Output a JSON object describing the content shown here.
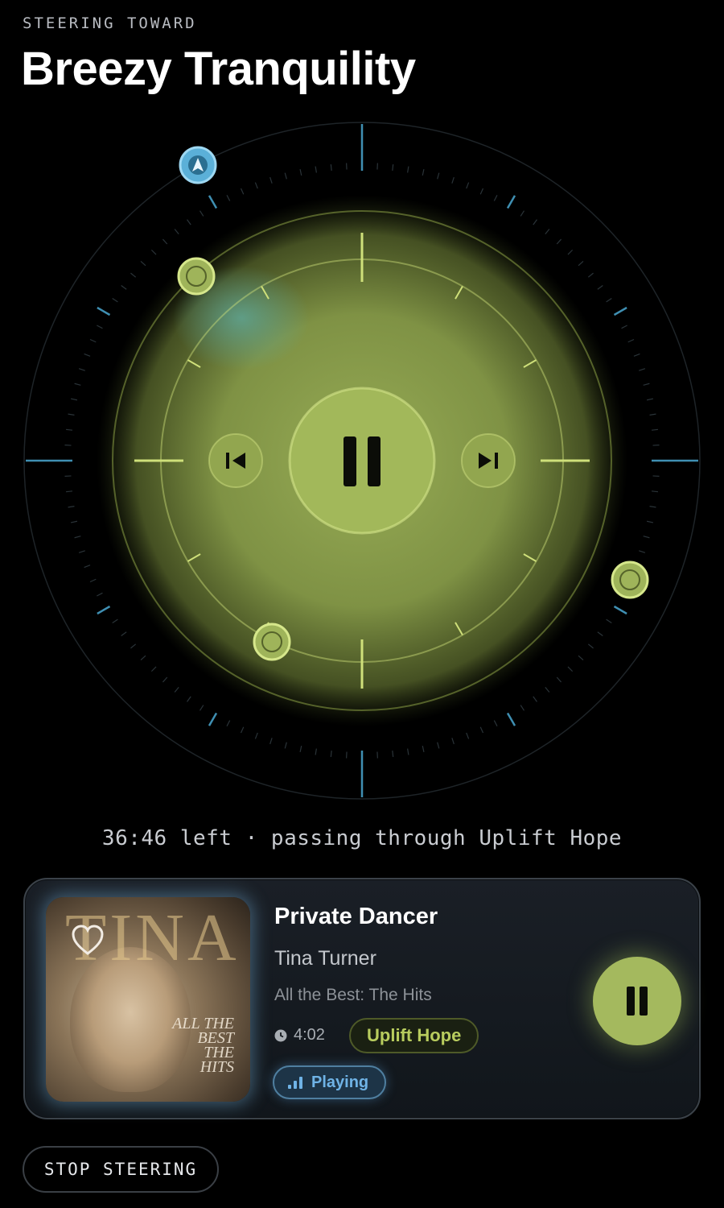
{
  "header": {
    "eyebrow": "STEERING TOWARD",
    "title": "Breezy Tranquility"
  },
  "status": {
    "text": "36:46 left · passing through Uplift Hope"
  },
  "now_playing": {
    "title": "Private Dancer",
    "artist": "Tina Turner",
    "album": "All the Best: The Hits",
    "duration": "4:02",
    "mood": "Uplift Hope",
    "state": "Playing",
    "art_word": "TINA",
    "art_subtitle": "ALL THE BEST THE HITS"
  },
  "footer": {
    "stop_label": "STOP STEERING"
  },
  "colors": {
    "accent_green": "#a4b95e",
    "accent_blue": "#6fb3e6",
    "background": "#000000"
  },
  "icons": {
    "target": "navigation-arrow-icon",
    "prev": "skip-back-icon",
    "next": "skip-forward-icon",
    "pause": "pause-icon",
    "favorite": "heart-icon",
    "duration": "clock-icon",
    "playing": "equalizer-bars-icon"
  }
}
